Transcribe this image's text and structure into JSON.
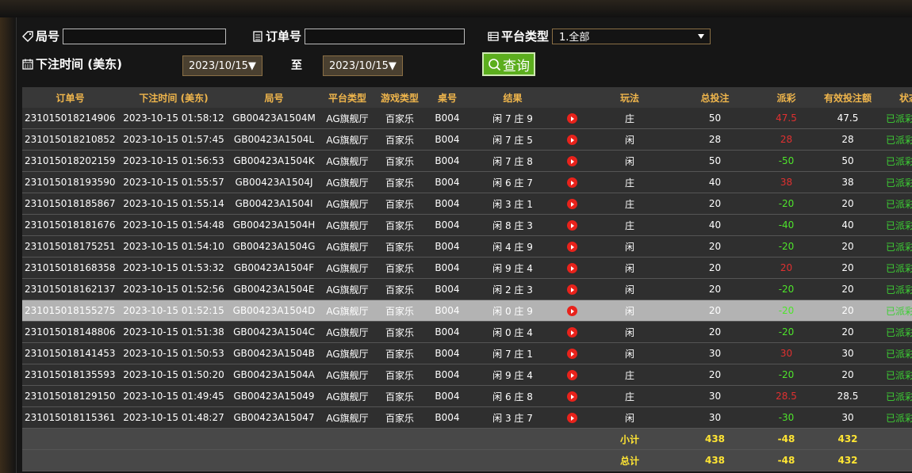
{
  "filters": {
    "game_no_label": "局号",
    "order_no_label": "订单号",
    "platform_label": "平台类型",
    "platform_value": "1.全部",
    "bet_time_label": "下注时间 (美东)",
    "date_from": "2023/10/15▼",
    "to_label": "至",
    "date_to": "2023/10/15▼",
    "query_label": "查询"
  },
  "table": {
    "headers": {
      "order": "订单号",
      "time": "下注时间 (美东)",
      "game": "局号",
      "platform": "平台类型",
      "type": "游戏类型",
      "table": "桌号",
      "result": "结果",
      "play": "玩法",
      "bet": "总投注",
      "payout": "派彩",
      "valid": "有效投注额",
      "status": "状态"
    },
    "rows": [
      {
        "order": "231015018214906",
        "time": "2023-10-15 01:58:12",
        "game": "GB00423A1504M",
        "platform": "AG旗舰厅",
        "type": "百家乐",
        "table": "B004",
        "result": "闲 7 庄 9",
        "play": "庄",
        "bet": "50",
        "payout": "47.5",
        "valid": "47.5",
        "status": "已派彩"
      },
      {
        "order": "231015018210852",
        "time": "2023-10-15 01:57:45",
        "game": "GB00423A1504L",
        "platform": "AG旗舰厅",
        "type": "百家乐",
        "table": "B004",
        "result": "闲 7 庄 5",
        "play": "闲",
        "bet": "28",
        "payout": "28",
        "valid": "28",
        "status": "已派彩"
      },
      {
        "order": "231015018202159",
        "time": "2023-10-15 01:56:53",
        "game": "GB00423A1504K",
        "platform": "AG旗舰厅",
        "type": "百家乐",
        "table": "B004",
        "result": "闲 7 庄 8",
        "play": "闲",
        "bet": "50",
        "payout": "-50",
        "valid": "50",
        "status": "已派彩"
      },
      {
        "order": "231015018193590",
        "time": "2023-10-15 01:55:57",
        "game": "GB00423A1504J",
        "platform": "AG旗舰厅",
        "type": "百家乐",
        "table": "B004",
        "result": "闲 6 庄 7",
        "play": "庄",
        "bet": "40",
        "payout": "38",
        "valid": "38",
        "status": "已派彩"
      },
      {
        "order": "231015018185867",
        "time": "2023-10-15 01:55:14",
        "game": "GB00423A1504I",
        "platform": "AG旗舰厅",
        "type": "百家乐",
        "table": "B004",
        "result": "闲 3 庄 1",
        "play": "庄",
        "bet": "20",
        "payout": "-20",
        "valid": "20",
        "status": "已派彩"
      },
      {
        "order": "231015018181676",
        "time": "2023-10-15 01:54:48",
        "game": "GB00423A1504H",
        "platform": "AG旗舰厅",
        "type": "百家乐",
        "table": "B004",
        "result": "闲 8 庄 3",
        "play": "庄",
        "bet": "40",
        "payout": "-40",
        "valid": "40",
        "status": "已派彩"
      },
      {
        "order": "231015018175251",
        "time": "2023-10-15 01:54:10",
        "game": "GB00423A1504G",
        "platform": "AG旗舰厅",
        "type": "百家乐",
        "table": "B004",
        "result": "闲 4 庄 9",
        "play": "闲",
        "bet": "20",
        "payout": "-20",
        "valid": "20",
        "status": "已派彩"
      },
      {
        "order": "231015018168358",
        "time": "2023-10-15 01:53:32",
        "game": "GB00423A1504F",
        "platform": "AG旗舰厅",
        "type": "百家乐",
        "table": "B004",
        "result": "闲 9 庄 4",
        "play": "闲",
        "bet": "20",
        "payout": "20",
        "valid": "20",
        "status": "已派彩"
      },
      {
        "order": "231015018162137",
        "time": "2023-10-15 01:52:56",
        "game": "GB00423A1504E",
        "platform": "AG旗舰厅",
        "type": "百家乐",
        "table": "B004",
        "result": "闲 2 庄 3",
        "play": "闲",
        "bet": "20",
        "payout": "-20",
        "valid": "20",
        "status": "已派彩"
      },
      {
        "order": "231015018155275",
        "time": "2023-10-15 01:52:15",
        "game": "GB00423A1504D",
        "platform": "AG旗舰厅",
        "type": "百家乐",
        "table": "B004",
        "result": "闲 0 庄 9",
        "play": "闲",
        "bet": "20",
        "payout": "-20",
        "valid": "20",
        "status": "已派彩"
      },
      {
        "order": "231015018148806",
        "time": "2023-10-15 01:51:38",
        "game": "GB00423A1504C",
        "platform": "AG旗舰厅",
        "type": "百家乐",
        "table": "B004",
        "result": "闲 0 庄 4",
        "play": "闲",
        "bet": "20",
        "payout": "-20",
        "valid": "20",
        "status": "已派彩"
      },
      {
        "order": "231015018141453",
        "time": "2023-10-15 01:50:53",
        "game": "GB00423A1504B",
        "platform": "AG旗舰厅",
        "type": "百家乐",
        "table": "B004",
        "result": "闲 7 庄 1",
        "play": "闲",
        "bet": "30",
        "payout": "30",
        "valid": "30",
        "status": "已派彩"
      },
      {
        "order": "231015018135593",
        "time": "2023-10-15 01:50:20",
        "game": "GB00423A1504A",
        "platform": "AG旗舰厅",
        "type": "百家乐",
        "table": "B004",
        "result": "闲 9 庄 4",
        "play": "庄",
        "bet": "20",
        "payout": "-20",
        "valid": "20",
        "status": "已派彩"
      },
      {
        "order": "231015018129150",
        "time": "2023-10-15 01:49:45",
        "game": "GB00423A15049",
        "platform": "AG旗舰厅",
        "type": "百家乐",
        "table": "B004",
        "result": "闲 6 庄 8",
        "play": "庄",
        "bet": "30",
        "payout": "28.5",
        "valid": "28.5",
        "status": "已派彩"
      },
      {
        "order": "231015018115361",
        "time": "2023-10-15 01:48:27",
        "game": "GB00423A15047",
        "platform": "AG旗舰厅",
        "type": "百家乐",
        "table": "B004",
        "result": "闲 3 庄 7",
        "play": "闲",
        "bet": "30",
        "payout": "-30",
        "valid": "30",
        "status": "已派彩"
      }
    ],
    "subtotal": {
      "label": "小计",
      "bet": "438",
      "payout": "-48",
      "valid": "432"
    },
    "total": {
      "label": "总计",
      "bet": "438",
      "payout": "-48",
      "valid": "432"
    }
  },
  "colors": {
    "header_text": "#f0b64c",
    "positive": "#e03030",
    "negative": "#4ee42b",
    "sum_text": "#ffe533",
    "query_button": "#5cae1e"
  },
  "icons": {
    "game_no": "tag-icon",
    "order_no": "receipt-icon",
    "platform": "list-icon",
    "bet_time": "calendar-icon",
    "query": "search-icon",
    "video": "play-icon",
    "dropdown": "caret-down-icon"
  }
}
